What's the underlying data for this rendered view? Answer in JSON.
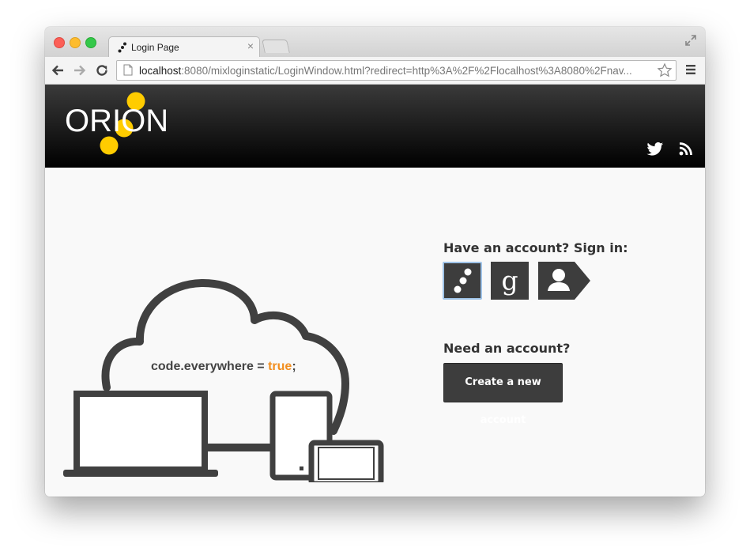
{
  "browser": {
    "tab_title": "Login Page",
    "tab_close": "×",
    "url_host": "localhost",
    "url_rest": ":8080/mixloginstatic/LoginWindow.html?redirect=http%3A%2F%2Flocalhost%3A8080%2Fnav..."
  },
  "header": {
    "logo_text": "ORION",
    "icons": [
      "twitter-icon",
      "rss-icon"
    ]
  },
  "illustration": {
    "code_prefix": "code.everywhere = ",
    "code_keyword": "true",
    "code_suffix": ";"
  },
  "signin": {
    "heading": "Have an account? Sign in:",
    "providers": [
      "orion-icon",
      "google-icon",
      "user-icon"
    ],
    "google_letter": "g"
  },
  "signup": {
    "heading": "Need an account?",
    "button_label": "Create a new account"
  },
  "colors": {
    "logo_dots": "#ffcc00",
    "keyword": "#f28e1e",
    "button_bg": "#3d3d3d"
  }
}
